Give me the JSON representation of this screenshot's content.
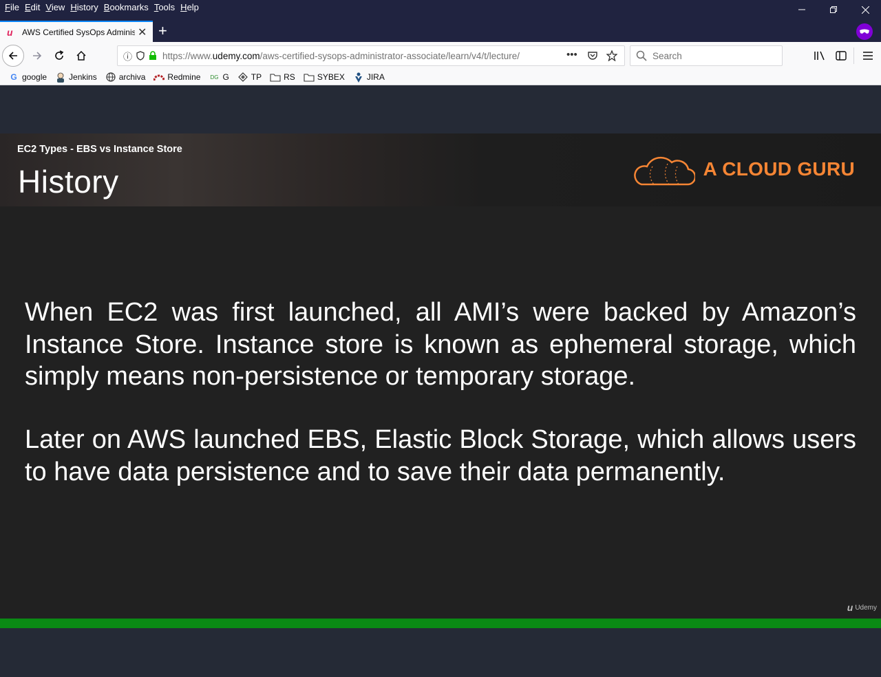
{
  "menu": [
    "File",
    "Edit",
    "View",
    "History",
    "Bookmarks",
    "Tools",
    "Help"
  ],
  "tab": {
    "title": "AWS Certified SysOps Administ",
    "favicon": "udemy-icon"
  },
  "navbar": {
    "url_prefix": "https://www.",
    "url_domain": "udemy.com",
    "url_path": "/aws-certified-sysops-administrator-associate/learn/v4/t/lecture/",
    "search_placeholder": "Search"
  },
  "bookmarks": [
    {
      "label": "google",
      "icon": "google-icon"
    },
    {
      "label": "Jenkins",
      "icon": "jenkins-icon"
    },
    {
      "label": "archiva",
      "icon": "globe-icon"
    },
    {
      "label": "Redmine",
      "icon": "redmine-icon"
    },
    {
      "label": "G",
      "icon": "dg-icon"
    },
    {
      "label": "TP",
      "icon": "tp-icon"
    },
    {
      "label": "RS",
      "icon": "folder-icon"
    },
    {
      "label": "SYBEX",
      "icon": "folder-icon"
    },
    {
      "label": "JIRA",
      "icon": "jira-icon"
    }
  ],
  "slide": {
    "subtitle": "EC2 Types - EBS vs Instance Store",
    "title": "History",
    "logo_text": "A CLOUD GURU",
    "paragraph1": "When EC2 was first launched, all AMI’s were backed by Amazon’s Instance Store. Instance store is known as ephemeral storage, which simply means non-persistence or temporary storage.",
    "paragraph2": "Later on AWS launched EBS, Elastic Block Storage, which allows users to have data persistence and to save their data permanently.",
    "watermark": "Udemy"
  },
  "colors": {
    "accent_orange": "#f58534",
    "progress_green": "#0a8a14",
    "private_purple": "#8000d7"
  }
}
